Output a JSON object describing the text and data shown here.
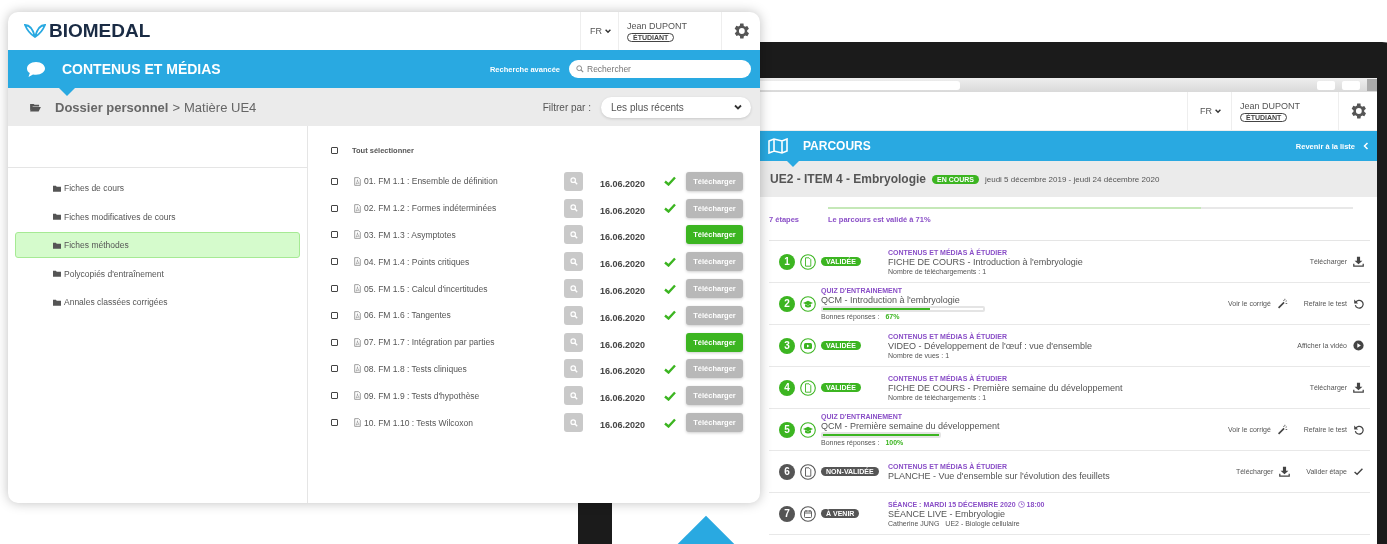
{
  "left_window": {
    "header": {
      "logo": "BIOMEDAL",
      "language": "FR",
      "user_name": "Jean DUPONT",
      "user_role": "ÉTUDIANT"
    },
    "section_bar": {
      "title": "CONTENUS ET MÉDIAS",
      "advanced_search": "Recherche avancée",
      "search_placeholder": "Rechercher"
    },
    "breadcrumb": {
      "items": [
        "Dossier personnel",
        "Matière UE4"
      ],
      "separator": ">"
    },
    "filter": {
      "label": "Filtrer par :",
      "value": "Les plus récents"
    },
    "folders": [
      {
        "name": "Fiches de cours",
        "selected": false
      },
      {
        "name": "Fiches modificatives de cours",
        "selected": false
      },
      {
        "name": "Fiches méthodes",
        "selected": true
      },
      {
        "name": "Polycopiés d'entraînement",
        "selected": false
      },
      {
        "name": "Annales classées corrigées",
        "selected": false
      }
    ],
    "select_all": {
      "label": "Tout sélectionner",
      "checked": false
    },
    "files": [
      {
        "title": "01. FM 1.1 : Ensemble de définition",
        "date": "16.06.2020",
        "downloaded": true,
        "checked": false,
        "button": "Télécharger"
      },
      {
        "title": "02. FM 1.2 : Formes indéterminées",
        "date": "16.06.2020",
        "downloaded": true,
        "checked": false,
        "button": "Télécharger"
      },
      {
        "title": "03. FM 1.3 : Asymptotes",
        "date": "16.06.2020",
        "downloaded": false,
        "checked": false,
        "button": "Télécharger"
      },
      {
        "title": "04. FM 1.4 : Points critiques",
        "date": "16.06.2020",
        "downloaded": true,
        "checked": false,
        "button": "Télécharger"
      },
      {
        "title": "05. FM 1.5 : Calcul d'incertitudes",
        "date": "16.06.2020",
        "downloaded": true,
        "checked": false,
        "button": "Télécharger"
      },
      {
        "title": "06. FM 1.6 : Tangentes",
        "date": "16.06.2020",
        "downloaded": true,
        "checked": false,
        "button": "Télécharger"
      },
      {
        "title": "07. FM 1.7 : Intégration par parties",
        "date": "16.06.2020",
        "downloaded": false,
        "checked": false,
        "button": "Télécharger"
      },
      {
        "title": "08. FM 1.8 : Tests cliniques",
        "date": "16.06.2020",
        "downloaded": true,
        "checked": false,
        "button": "Télécharger"
      },
      {
        "title": "09. FM 1.9 : Tests d'hypothèse",
        "date": "16.06.2020",
        "downloaded": true,
        "checked": false,
        "button": "Télécharger"
      },
      {
        "title": "10. FM 1.10 : Tests Wilcoxon",
        "date": "16.06.2020",
        "downloaded": true,
        "checked": false,
        "button": "Télécharger"
      }
    ]
  },
  "right_window": {
    "header": {
      "language": "FR",
      "user_name": "Jean DUPONT",
      "user_role": "ÉTUDIANT"
    },
    "section_bar": {
      "title": "PARCOURS",
      "back_link": "Revenir à la liste"
    },
    "course": {
      "title": "UE2 - ITEM 4 - Embryologie",
      "status": "EN COURS",
      "dates": "jeudi  5 décembre 2019 - jeudi 24 décembre 2020"
    },
    "progress": {
      "steps": "7 étapes",
      "summary": "Le parcours est validé à 71%",
      "level": 0.71
    },
    "steps": [
      {
        "number": "1",
        "done": true,
        "kind": "pdf",
        "badge": "VALIDÉE",
        "category": "CONTENUS ET MÉDIAS À ÉTUDIER",
        "title": "FICHE DE COURS - Introduction à l'embryologie",
        "meta": [
          "Nombre de téléchargements : 1"
        ],
        "actions": [
          {
            "label": "Télécharger",
            "kind": "download"
          }
        ]
      },
      {
        "number": "2",
        "done": true,
        "kind": "quiz",
        "category": "QUIZ D'ENTRAINEMENT",
        "title": "QCM - Introduction à l'embryologie",
        "score": {
          "label": "Bonnes réponses :",
          "value": "67%",
          "level": 0.67
        },
        "actions": [
          {
            "label": "Voir le corrigé",
            "kind": "wand"
          },
          {
            "label": "Refaire le test",
            "kind": "undo"
          }
        ]
      },
      {
        "number": "3",
        "done": true,
        "kind": "video",
        "badge": "VALIDÉE",
        "category": "CONTENUS ET MÉDIAS À ÉTUDIER",
        "title": "VIDEO - Développement de l'œuf : vue d'ensemble",
        "meta": [
          "Nombre de vues : 1"
        ],
        "actions": [
          {
            "label": "Afficher la vidéo",
            "kind": "play"
          }
        ]
      },
      {
        "number": "4",
        "done": true,
        "kind": "pdf",
        "badge": "VALIDÉE",
        "category": "CONTENUS ET MÉDIAS À ÉTUDIER",
        "title": "FICHE DE COURS - Première semaine du développement",
        "meta": [
          "Nombre de téléchargements : 1"
        ],
        "actions": [
          {
            "label": "Télécharger",
            "kind": "download"
          }
        ]
      },
      {
        "number": "5",
        "done": true,
        "kind": "quiz",
        "category": "QUIZ D'ENTRAINEMENT",
        "title": "QCM - Première semaine du développement",
        "score": {
          "label": "Bonnes réponses :",
          "value": "100%",
          "level": 1
        },
        "actions": [
          {
            "label": "Voir le corrigé",
            "kind": "wand"
          },
          {
            "label": "Refaire le test",
            "kind": "undo"
          }
        ]
      },
      {
        "number": "6",
        "done": false,
        "kind": "pdf",
        "badge": "NON-VALIDÉE",
        "category": "CONTENUS ET MÉDIAS À ÉTUDIER",
        "title": "PLANCHE - Vue d'ensemble sur l'évolution des feuillets",
        "actions": [
          {
            "label": "Télécharger",
            "kind": "download"
          },
          {
            "label": "Valider étape",
            "kind": "check"
          }
        ]
      },
      {
        "number": "7",
        "done": false,
        "kind": "calendar",
        "badge": "À VENIR",
        "category": "SÉANCE : MARDI 15 DÉCEMBRE 2020",
        "time": "18:00",
        "title": "SÉANCE LIVE - Embryologie",
        "meta": [
          "Catherine JUNG",
          "UE2 - Biologie cellulaire"
        ]
      }
    ]
  }
}
